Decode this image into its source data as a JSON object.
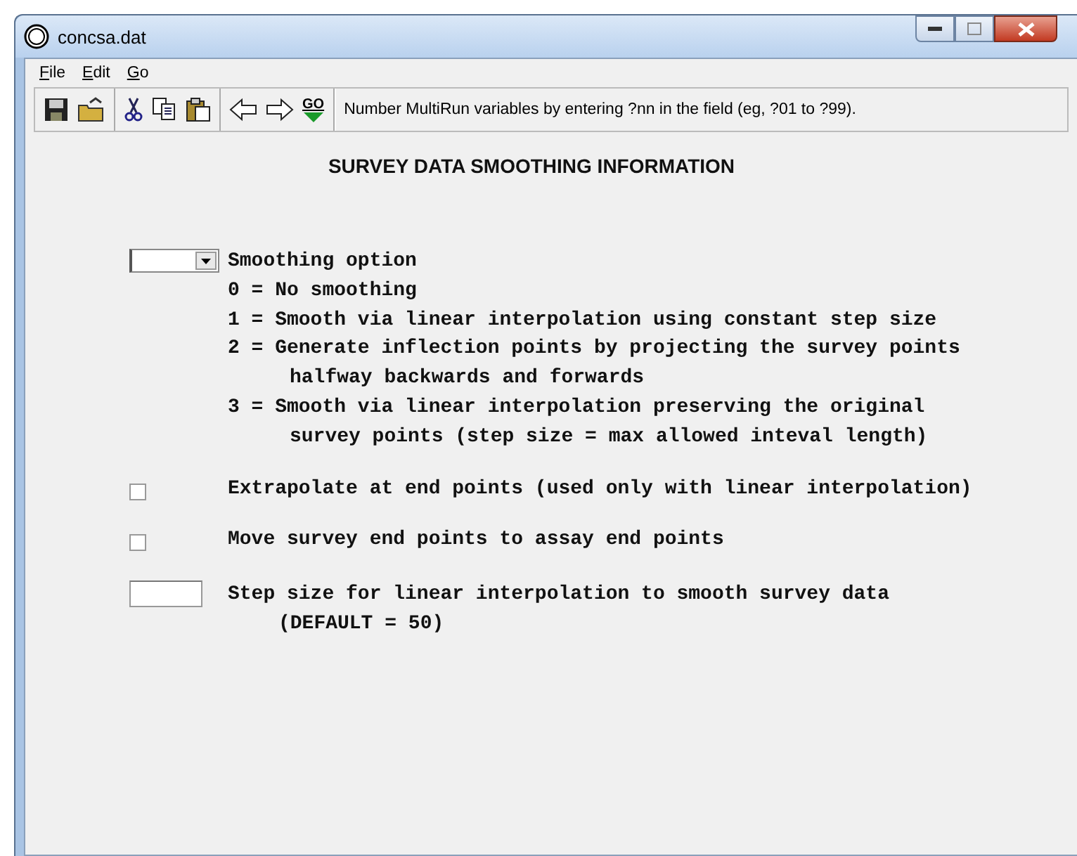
{
  "window": {
    "title": "concsa.dat"
  },
  "menu": [
    {
      "label": "File"
    },
    {
      "label": "Edit"
    },
    {
      "label": "Go"
    }
  ],
  "toolbar": {
    "go_label": "GO",
    "hint": "Number MultiRun variables by entering ?nn in the field (eg, ?01 to ?99)."
  },
  "heading": "SURVEY DATA SMOOTHING INFORMATION",
  "smoothing": {
    "label": "Smoothing option",
    "options": [
      {
        "lines": [
          "0 = No smoothing"
        ]
      },
      {
        "lines": [
          "1 = Smooth via linear interpolation using constant step size"
        ]
      },
      {
        "lines": [
          "2 = Generate inflection points by projecting the survey points",
          "halfway backwards and forwards"
        ]
      },
      {
        "lines": [
          "3 = Smooth via linear interpolation preserving the original",
          "survey points (step size = max allowed inteval length)"
        ]
      }
    ]
  },
  "checks": [
    {
      "label": "Extrapolate at end points (used only with linear interpolation)",
      "checked": false
    },
    {
      "label": "Move survey end points to assay end points",
      "checked": false
    }
  ],
  "step": {
    "label": "Step size for linear interpolation to smooth survey data",
    "note": "(DEFAULT = 50)"
  }
}
